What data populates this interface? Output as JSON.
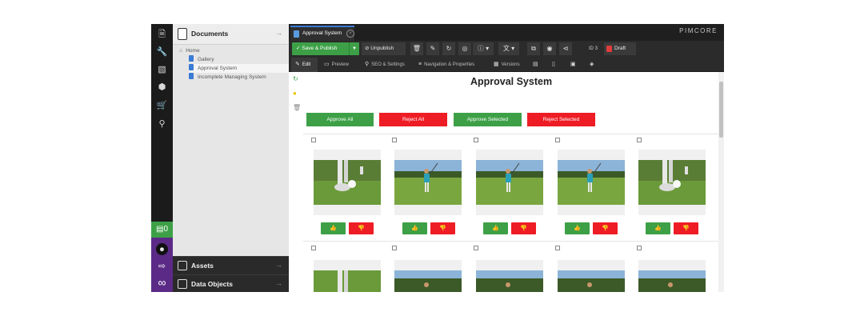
{
  "sidebar": {
    "icons": [
      "document-icon",
      "wrench-icon",
      "chart-icon",
      "cube-icon",
      "cart-icon",
      "search-icon"
    ],
    "notification_count": "0"
  },
  "tree": {
    "title": "Documents",
    "items": [
      {
        "label": "Home",
        "level": 0
      },
      {
        "label": "Gallery",
        "level": 1
      },
      {
        "label": "Approval System",
        "level": 1,
        "selected": true
      },
      {
        "label": "Incomplete Managing System",
        "level": 1
      }
    ],
    "assets_label": "Assets",
    "data_objects_label": "Data Objects"
  },
  "tabs": {
    "active_tab": "Approval System",
    "logo": "PIMCORE"
  },
  "toolbar": {
    "save_publish": "Save & Publish",
    "unpublish": "Unpublish",
    "id_label": "ID 3",
    "draft": "Draft"
  },
  "subtabs": [
    "Edit",
    "Preview",
    "SEO & Settings",
    "Navigation & Properties",
    "Versions"
  ],
  "page": {
    "title": "Approval System",
    "approve_all": "Approve All",
    "reject_all": "Reject All",
    "approve_selected": "Approve Selected",
    "reject_selected": "Reject Selected"
  },
  "colors": {
    "accent_green": "#3da047",
    "accent_red": "#ee1c24",
    "accent_purple": "#5b2a86",
    "doc_blue": "#3a7bd5"
  }
}
